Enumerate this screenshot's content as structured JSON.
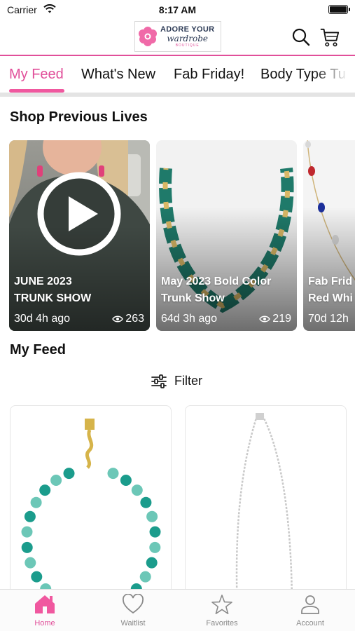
{
  "status_bar": {
    "carrier": "Carrier",
    "time": "8:17 AM"
  },
  "brand": {
    "logo_line1": "ADORE YOUR",
    "logo_line2": "wardrobe",
    "logo_line3": "BOUTIQUE",
    "accent_color": "#e14f9a"
  },
  "header": {
    "search_icon": "search-icon",
    "cart_icon": "cart-icon"
  },
  "tabs": [
    {
      "label": "My Feed",
      "active": true
    },
    {
      "label": "What's New",
      "active": false
    },
    {
      "label": "Fab Friday!",
      "active": false
    },
    {
      "label": "Body Type Tu",
      "active": false
    }
  ],
  "lives_section": {
    "title": "Shop Previous Lives",
    "items": [
      {
        "title_line1": "JUNE 2023",
        "title_line2": "TRUNK SHOW",
        "age": "30d 4h ago",
        "views": "263"
      },
      {
        "title_line1": "May 2023 Bold Color",
        "title_line2": "Trunk Show",
        "age": "64d 3h ago",
        "views": "219"
      },
      {
        "title_line1": "Fab Frid",
        "title_line2": "Red Whi",
        "age": "70d 12h",
        "views": ""
      }
    ]
  },
  "feed_section": {
    "title": "My Feed",
    "filter_label": "Filter"
  },
  "bottom_nav": [
    {
      "label": "Home",
      "icon": "home-icon",
      "active": true
    },
    {
      "label": "Waitlist",
      "icon": "heart-icon",
      "active": false
    },
    {
      "label": "Favorites",
      "icon": "star-icon",
      "active": false
    },
    {
      "label": "Account",
      "icon": "user-icon",
      "active": false
    }
  ]
}
